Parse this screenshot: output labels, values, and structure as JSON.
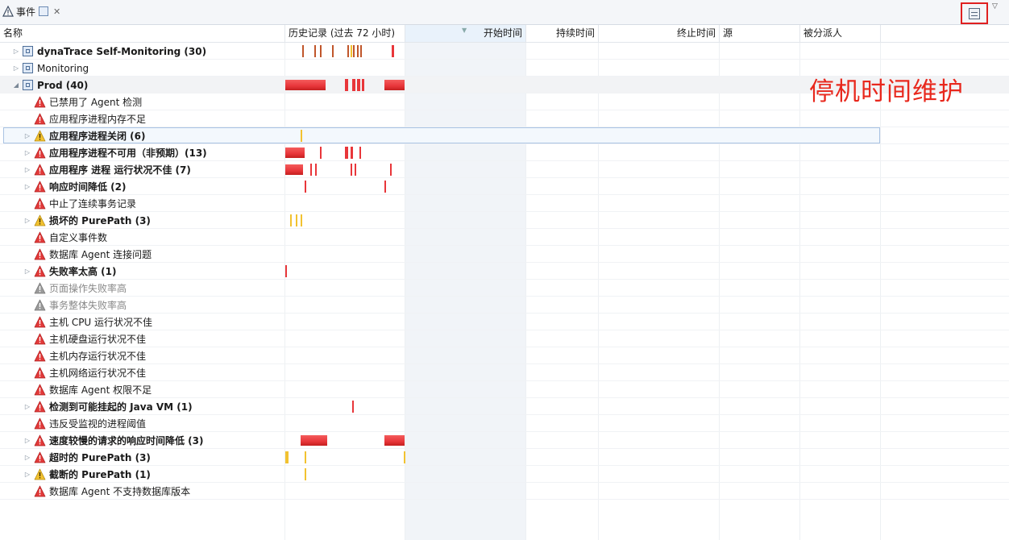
{
  "tab": {
    "title": "事件",
    "icon": "warning-triangle-icon",
    "pin_icon": "view-pin-icon",
    "close_icon": "close-icon"
  },
  "view_menu": {
    "icon": "view-menu-icon",
    "dropdown_icon": "chevron-down-icon",
    "highlight_color": "#e02020"
  },
  "columns": [
    {
      "key": "name",
      "label": "名称"
    },
    {
      "key": "history",
      "label": "历史记录 (过去 72 小时)"
    },
    {
      "key": "start",
      "label": "开始时间"
    },
    {
      "key": "duration",
      "label": "持续时间"
    },
    {
      "key": "end",
      "label": "终止时间"
    },
    {
      "key": "source",
      "label": "源"
    },
    {
      "key": "assignee",
      "label": "被分派人"
    }
  ],
  "colors": {
    "severe": "#e8363a",
    "warning": "#f2c230",
    "mixed": "#c0562b",
    "selection_border": "#a9c3e3",
    "annotation": "#e8281d"
  },
  "rows": [
    {
      "label": "dynaTrace Self-Monitoring (30)",
      "level": 0,
      "expandable": true,
      "expanded": false,
      "icon": "group",
      "bold": true,
      "marks": [
        [
          0.14,
          0.006,
          "mixed"
        ],
        [
          0.24,
          0.006,
          "mixed"
        ],
        [
          0.29,
          0.006,
          "mixed"
        ],
        [
          0.39,
          0.006,
          "mixed"
        ],
        [
          0.52,
          0.006,
          "mixed"
        ],
        [
          0.545,
          0.006,
          "warning"
        ],
        [
          0.57,
          0.006,
          "mixed"
        ],
        [
          0.6,
          0.006,
          "mixed"
        ],
        [
          0.625,
          0.006,
          "mixed"
        ],
        [
          0.89,
          0.02,
          "severe"
        ]
      ]
    },
    {
      "label": "Monitoring",
      "level": 0,
      "expandable": true,
      "expanded": false,
      "icon": "group",
      "bold": false,
      "marks": []
    },
    {
      "label": "Prod (40)",
      "level": 0,
      "expandable": true,
      "expanded": true,
      "icon": "group",
      "bold": true,
      "marks": [
        [
          0.0,
          0.34,
          "severe"
        ],
        [
          0.5,
          0.03,
          "severe"
        ],
        [
          0.56,
          0.03,
          "severe"
        ],
        [
          0.6,
          0.03,
          "severe"
        ],
        [
          0.64,
          0.02,
          "severe"
        ],
        [
          0.83,
          0.17,
          "severe"
        ]
      ]
    },
    {
      "label": "已禁用了 Agent 检测",
      "level": 1,
      "expandable": false,
      "icon": "severe",
      "bold": false,
      "marks": []
    },
    {
      "label": "应用程序进程内存不足",
      "level": 1,
      "expandable": false,
      "icon": "severe",
      "bold": false,
      "marks": []
    },
    {
      "label": "应用程序进程关闭 (6)",
      "level": 1,
      "expandable": true,
      "expanded": false,
      "icon": "warning",
      "bold": true,
      "selected": true,
      "marks": [
        [
          0.13,
          0.007,
          "warning"
        ]
      ]
    },
    {
      "label": "应用程序进程不可用（非预期）(13)",
      "level": 1,
      "expandable": true,
      "expanded": false,
      "icon": "severe",
      "bold": true,
      "marks": [
        [
          0.0,
          0.16,
          "severe"
        ],
        [
          0.29,
          0.01,
          "severe"
        ],
        [
          0.5,
          0.03,
          "severe"
        ],
        [
          0.55,
          0.02,
          "severe"
        ],
        [
          0.62,
          0.01,
          "severe"
        ]
      ]
    },
    {
      "label": "应用程序 进程 运行状况不佳 (7)",
      "level": 1,
      "expandable": true,
      "expanded": false,
      "icon": "severe",
      "bold": true,
      "marks": [
        [
          0.0,
          0.15,
          "severe"
        ],
        [
          0.21,
          0.01,
          "severe"
        ],
        [
          0.25,
          0.01,
          "severe"
        ],
        [
          0.55,
          0.01,
          "severe"
        ],
        [
          0.58,
          0.01,
          "severe"
        ],
        [
          0.88,
          0.01,
          "severe"
        ]
      ]
    },
    {
      "label": "响应时间降低 (2)",
      "level": 1,
      "expandable": true,
      "expanded": false,
      "icon": "severe",
      "bold": true,
      "marks": [
        [
          0.16,
          0.01,
          "severe"
        ],
        [
          0.83,
          0.01,
          "severe"
        ]
      ]
    },
    {
      "label": "中止了连续事务记录",
      "level": 1,
      "expandable": false,
      "icon": "severe",
      "bold": false,
      "marks": []
    },
    {
      "label": "损坏的 PurePath (3)",
      "level": 1,
      "expandable": true,
      "expanded": false,
      "icon": "warning",
      "bold": true,
      "marks": [
        [
          0.04,
          0.007,
          "warning"
        ],
        [
          0.09,
          0.007,
          "warning"
        ],
        [
          0.13,
          0.007,
          "warning"
        ]
      ]
    },
    {
      "label": "自定义事件数",
      "level": 1,
      "expandable": false,
      "icon": "severe",
      "bold": false,
      "marks": []
    },
    {
      "label": "数据库 Agent 连接问题",
      "level": 1,
      "expandable": false,
      "icon": "severe",
      "bold": false,
      "marks": []
    },
    {
      "label": "失败率太高 (1)",
      "level": 1,
      "expandable": true,
      "expanded": false,
      "icon": "severe",
      "bold": true,
      "marks": [
        [
          0.0,
          0.01,
          "severe"
        ]
      ]
    },
    {
      "label": "页面操作失败率高",
      "level": 1,
      "expandable": false,
      "icon": "disabled",
      "bold": false,
      "gray": true,
      "marks": []
    },
    {
      "label": "事务整体失败率高",
      "level": 1,
      "expandable": false,
      "icon": "disabled",
      "bold": false,
      "gray": true,
      "marks": []
    },
    {
      "label": "主机 CPU 运行状况不佳",
      "level": 1,
      "expandable": false,
      "icon": "severe",
      "bold": false,
      "marks": []
    },
    {
      "label": "主机硬盘运行状况不佳",
      "level": 1,
      "expandable": false,
      "icon": "severe",
      "bold": false,
      "marks": []
    },
    {
      "label": "主机内存运行状况不佳",
      "level": 1,
      "expandable": false,
      "icon": "severe",
      "bold": false,
      "marks": []
    },
    {
      "label": "主机网络运行状况不佳",
      "level": 1,
      "expandable": false,
      "icon": "severe",
      "bold": false,
      "marks": []
    },
    {
      "label": "数据库 Agent 权限不足",
      "level": 1,
      "expandable": false,
      "icon": "severe",
      "bold": false,
      "marks": []
    },
    {
      "label": "检测到可能挂起的 Java VM (1)",
      "level": 1,
      "expandable": true,
      "expanded": false,
      "icon": "severe",
      "bold": true,
      "marks": [
        [
          0.56,
          0.01,
          "severe"
        ]
      ]
    },
    {
      "label": "违反受监视的进程阈值",
      "level": 1,
      "expandable": false,
      "icon": "severe",
      "bold": false,
      "marks": []
    },
    {
      "label": "速度较慢的请求的响应时间降低 (3)",
      "level": 1,
      "expandable": true,
      "expanded": false,
      "icon": "severe",
      "bold": true,
      "marks": [
        [
          0.13,
          0.22,
          "severe"
        ],
        [
          0.83,
          0.17,
          "severe"
        ]
      ]
    },
    {
      "label": "超时的 PurePath (3)",
      "level": 1,
      "expandable": true,
      "expanded": false,
      "icon": "severe",
      "bold": true,
      "marks": [
        [
          0.0,
          0.03,
          "warning"
        ],
        [
          0.16,
          0.007,
          "warning"
        ],
        [
          0.99,
          0.01,
          "warning"
        ]
      ]
    },
    {
      "label": "截断的 PurePath (1)",
      "level": 1,
      "expandable": true,
      "expanded": false,
      "icon": "warning",
      "bold": true,
      "marks": [
        [
          0.16,
          0.007,
          "warning"
        ]
      ]
    },
    {
      "label": "数据库 Agent 不支持数据库版本",
      "level": 1,
      "expandable": false,
      "icon": "severe",
      "bold": false,
      "marks": []
    }
  ],
  "annotation": "停机时间维护"
}
